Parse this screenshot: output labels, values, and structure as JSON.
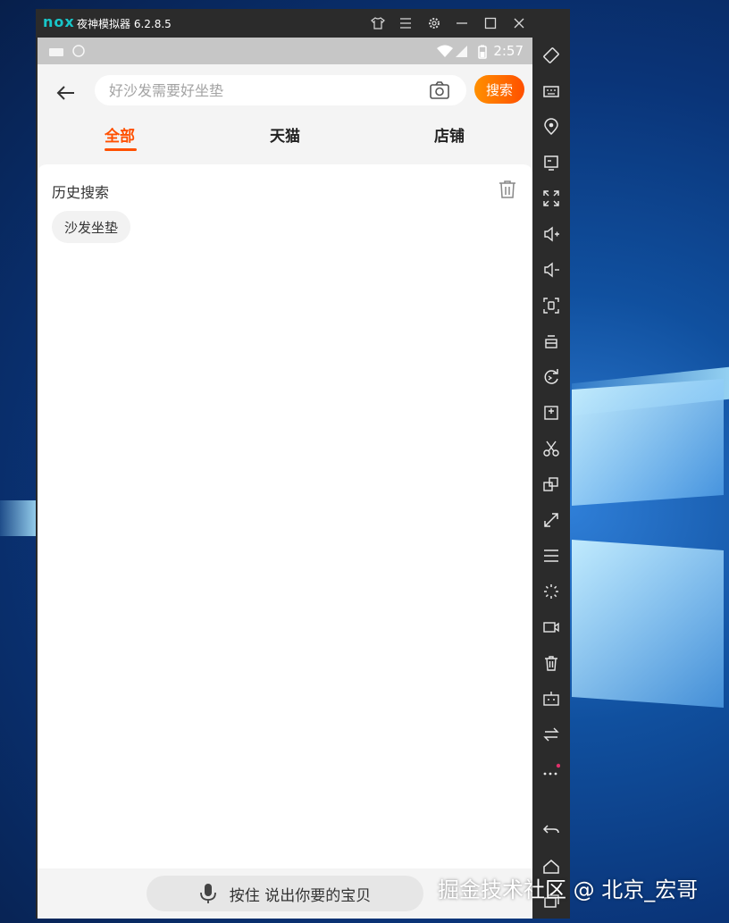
{
  "window": {
    "logo": "nox",
    "title": "夜神模拟器 6.2.8.5",
    "buttons": [
      "skin-icon",
      "menu-icon",
      "settings-icon",
      "minimize-icon",
      "maximize-icon",
      "close-icon",
      "collapse-icon"
    ]
  },
  "statusbar": {
    "time": "2:57"
  },
  "search": {
    "placeholder": "好沙发需要好坐垫",
    "button_label": "搜索"
  },
  "tabs": [
    {
      "label": "全部",
      "active": true
    },
    {
      "label": "天猫",
      "active": false
    },
    {
      "label": "店铺",
      "active": false
    }
  ],
  "history": {
    "title": "历史搜索",
    "items": [
      "沙发坐垫"
    ]
  },
  "voice": {
    "label": "按住 说出你要的宝贝"
  },
  "sidebar": {
    "icons": [
      "rotate-icon",
      "keyboard-icon",
      "location-icon",
      "screen-icon",
      "fullscreen-icon",
      "volume-up-icon",
      "volume-down-icon",
      "screenshot-icon",
      "apk-install-icon",
      "sync-icon",
      "add-apk-icon",
      "cut-icon",
      "multi-instance-icon",
      "resize-icon",
      "menu-icon",
      "loading-icon",
      "video-record-icon",
      "delete-icon",
      "robot-icon",
      "swap-icon",
      "more-icon",
      "back-icon",
      "home-icon",
      "recent-icon"
    ]
  },
  "watermark": "掘金技术社区 @ 北京_宏哥",
  "colors": {
    "accent": "#ff5000",
    "search_button_start": "#ff9000",
    "emulator_chrome": "#2b2b2b",
    "statusbar": "#c6c6c6"
  }
}
